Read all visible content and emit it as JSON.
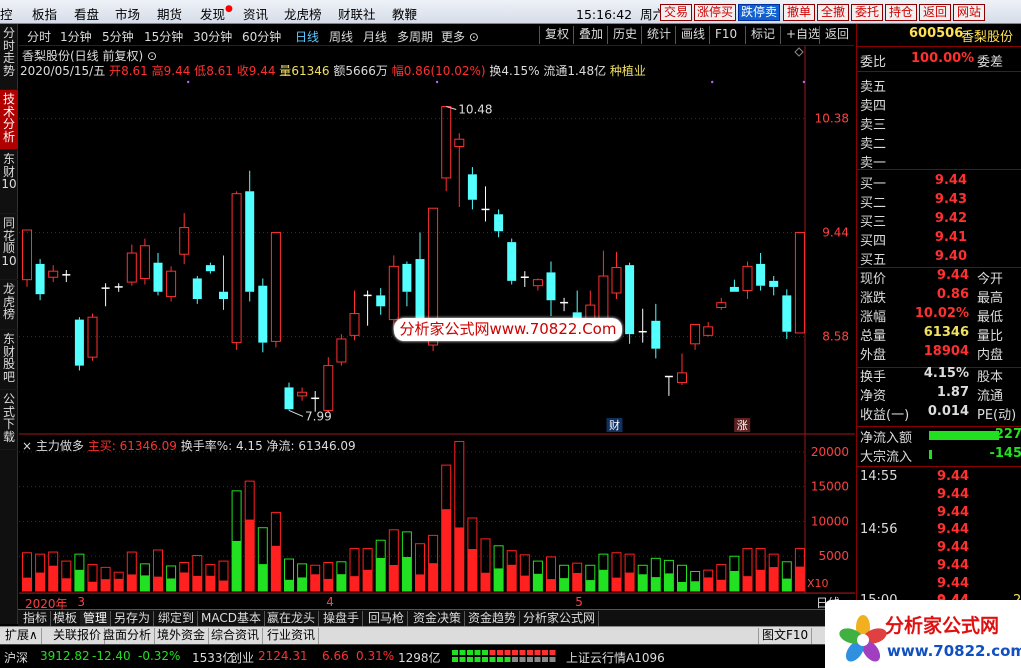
{
  "menubar": {
    "items": [
      "控",
      "板指",
      "看盘",
      "市场",
      "期货",
      "发现",
      "资讯",
      "龙虎榜",
      "财联社",
      "教鞭"
    ],
    "clock": "15:16:42",
    "weekday": "周六",
    "trade_buttons": [
      "交易",
      "涨停买",
      "跌停卖",
      "撤单",
      "全撤",
      "委托",
      "持仓",
      "返回",
      "网站"
    ]
  },
  "left_tabs": [
    {
      "label": "分时走势",
      "active": false
    },
    {
      "label": "技术分析",
      "active": true
    },
    {
      "label": "东财10",
      "active": false
    },
    {
      "label": "同花顺10",
      "active": false
    },
    {
      "label": "龙虎榜",
      "active": false
    },
    {
      "label": "东财股吧",
      "active": false
    },
    {
      "label": "公式下载",
      "active": false
    }
  ],
  "periods": [
    "分时",
    "1分钟",
    "5分钟",
    "15分钟",
    "30分钟",
    "60分钟",
    "日线",
    "周线",
    "月线",
    "多周期",
    "更多"
  ],
  "period_selected": "日线",
  "tools": [
    "复权",
    "叠加",
    "历史",
    "统计",
    "画线",
    "F10",
    "标记",
    "+自选",
    "返回"
  ],
  "stock": {
    "title": "香梨股份(日线 前复权)",
    "date": "2020/05/15/五",
    "open_label": "开",
    "open": "8.61",
    "high_label": "高",
    "high": "9.44",
    "low_label": "低",
    "low": "8.61",
    "close_label": "收",
    "close": "9.44",
    "vol_label": "量",
    "vol": "61346",
    "amt_label": "额",
    "amt": "5666万",
    "amp_label": "幅",
    "amp": "0.86(10.02%)",
    "turnover": "换4.15%",
    "float": "流通1.48亿",
    "sector": "种植业"
  },
  "watermark": "分析家公式网www.70822.Com",
  "sub_indicator": {
    "name": "主力做多",
    "buy_label": "主买:",
    "buy": "61346.09",
    "tr_label": "换手率%:",
    "tr": "4.15",
    "net_label": "净流:",
    "net": "61346.09"
  },
  "chart_data": {
    "type": "candlestick",
    "y_labels": [
      "10.38",
      "9.44",
      "8.58"
    ],
    "ylim": [
      7.8,
      10.6
    ],
    "hi_mark": "10.48",
    "lo_mark": "7.99",
    "vol_ticks": [
      "20000",
      "15000",
      "10000",
      "5000"
    ],
    "vol_scale": "X10",
    "vol_max": 22000,
    "candles": [
      [
        9.05,
        9.46,
        8.99,
        9.46
      ],
      [
        9.18,
        8.93,
        8.88,
        9.22
      ],
      [
        9.07,
        9.12,
        9.03,
        9.17
      ],
      [
        9.1,
        9.09,
        9.03,
        9.13
      ],
      [
        8.72,
        8.34,
        8.3,
        8.74
      ],
      [
        8.41,
        8.74,
        8.38,
        8.77
      ],
      [
        8.96,
        8.98,
        8.83,
        9.02
      ],
      [
        8.97,
        8.99,
        8.95,
        9.02
      ],
      [
        9.03,
        9.27,
        9.0,
        9.34
      ],
      [
        9.06,
        9.33,
        9.01,
        9.39
      ],
      [
        9.19,
        8.95,
        8.92,
        9.27
      ],
      [
        8.91,
        9.12,
        8.87,
        9.16
      ],
      [
        9.26,
        9.48,
        9.18,
        9.6
      ],
      [
        9.06,
        8.89,
        8.85,
        9.08
      ],
      [
        9.17,
        9.12,
        9.1,
        9.19
      ],
      [
        8.95,
        8.89,
        8.8,
        9.25
      ],
      [
        8.53,
        9.76,
        8.47,
        9.78
      ],
      [
        9.78,
        8.95,
        8.87,
        9.95
      ],
      [
        9.0,
        8.53,
        8.45,
        9.06
      ],
      [
        8.54,
        9.44,
        8.49,
        9.44
      ],
      [
        8.16,
        7.98,
        7.97,
        8.2
      ],
      [
        8.09,
        8.12,
        8.05,
        8.16
      ],
      [
        8.08,
        8.07,
        7.96,
        8.13
      ],
      [
        7.97,
        8.34,
        7.95,
        8.41
      ],
      [
        8.37,
        8.56,
        8.34,
        8.6
      ],
      [
        8.59,
        8.77,
        8.55,
        8.96
      ],
      [
        8.9,
        8.92,
        8.67,
        8.96
      ],
      [
        8.92,
        8.83,
        8.76,
        8.98
      ],
      [
        8.72,
        9.16,
        8.63,
        9.25
      ],
      [
        9.18,
        8.95,
        8.83,
        9.2
      ],
      [
        9.22,
        8.69,
        8.61,
        9.44
      ],
      [
        8.51,
        9.64,
        8.46,
        9.64
      ],
      [
        9.89,
        10.48,
        9.78,
        10.48
      ],
      [
        10.15,
        10.21,
        9.65,
        10.26
      ],
      [
        9.92,
        9.71,
        9.63,
        9.98
      ],
      [
        9.63,
        9.63,
        9.53,
        9.82
      ],
      [
        9.59,
        9.45,
        9.4,
        9.63
      ],
      [
        9.36,
        9.04,
        9.01,
        9.39
      ],
      [
        9.07,
        9.07,
        8.99,
        9.12
      ],
      [
        9.0,
        9.05,
        8.96,
        9.06
      ],
      [
        9.11,
        8.88,
        8.75,
        9.2
      ],
      [
        8.84,
        8.86,
        8.79,
        8.9
      ],
      [
        8.78,
        8.68,
        8.62,
        8.96
      ],
      [
        8.67,
        8.84,
        8.64,
        8.96
      ],
      [
        8.63,
        9.08,
        8.61,
        9.29
      ],
      [
        8.94,
        9.15,
        8.89,
        9.28
      ],
      [
        9.17,
        8.6,
        8.52,
        9.19
      ],
      [
        8.6,
        8.62,
        8.53,
        8.81
      ],
      [
        8.71,
        8.48,
        8.4,
        8.85
      ],
      [
        8.24,
        8.25,
        8.09,
        8.25
      ],
      [
        8.2,
        8.28,
        8.18,
        8.44
      ],
      [
        8.52,
        8.68,
        8.47,
        8.68
      ],
      [
        8.59,
        8.66,
        8.58,
        8.7
      ],
      [
        8.82,
        8.86,
        8.8,
        8.9
      ],
      [
        8.99,
        8.95,
        8.95,
        9.05
      ],
      [
        8.96,
        9.16,
        8.89,
        9.2
      ],
      [
        9.18,
        9.0,
        8.96,
        9.27
      ],
      [
        9.04,
        8.99,
        8.92,
        9.08
      ],
      [
        8.92,
        8.62,
        8.56,
        8.97
      ],
      [
        8.61,
        9.44,
        8.61,
        9.44
      ]
    ],
    "volumes": [
      [
        5500,
        1
      ],
      [
        5300,
        1
      ],
      [
        5600,
        1
      ],
      [
        4300,
        1
      ],
      [
        5300,
        0
      ],
      [
        3800,
        1
      ],
      [
        3400,
        1
      ],
      [
        2700,
        1
      ],
      [
        5600,
        1
      ],
      [
        3900,
        0
      ],
      [
        5900,
        1
      ],
      [
        3600,
        0
      ],
      [
        4100,
        1
      ],
      [
        5100,
        1
      ],
      [
        3800,
        1
      ],
      [
        4300,
        1
      ],
      [
        14400,
        0
      ],
      [
        15800,
        1
      ],
      [
        9100,
        0
      ],
      [
        11300,
        1
      ],
      [
        4600,
        0
      ],
      [
        3900,
        0
      ],
      [
        3700,
        1
      ],
      [
        4100,
        1
      ],
      [
        4200,
        0
      ],
      [
        6100,
        1
      ],
      [
        6100,
        1
      ],
      [
        7300,
        0
      ],
      [
        8800,
        1
      ],
      [
        8500,
        0
      ],
      [
        6800,
        1
      ],
      [
        8000,
        1
      ],
      [
        18100,
        1
      ],
      [
        21500,
        1
      ],
      [
        10500,
        1
      ],
      [
        7500,
        1
      ],
      [
        6500,
        0
      ],
      [
        5800,
        1
      ],
      [
        5200,
        1
      ],
      [
        4300,
        0
      ],
      [
        4900,
        1
      ],
      [
        3700,
        0
      ],
      [
        4000,
        1
      ],
      [
        3700,
        0
      ],
      [
        5300,
        0
      ],
      [
        5500,
        1
      ],
      [
        5300,
        1
      ],
      [
        3700,
        0
      ],
      [
        4700,
        0
      ],
      [
        4400,
        0
      ],
      [
        3700,
        0
      ],
      [
        2800,
        0
      ],
      [
        3000,
        1
      ],
      [
        3800,
        1
      ],
      [
        5000,
        0
      ],
      [
        6100,
        1
      ],
      [
        6100,
        1
      ],
      [
        5300,
        1
      ],
      [
        4200,
        0
      ],
      [
        6100,
        1
      ]
    ],
    "x_labels": [
      {
        "label": "2020年",
        "idx": 0
      },
      {
        "label": "3",
        "idx": 4
      },
      {
        "label": "4",
        "idx": 23
      },
      {
        "label": "5",
        "idx": 42
      }
    ],
    "period_label": "日线",
    "badges": [
      {
        "label": "财",
        "idx": 45
      },
      {
        "label": "涨",
        "idx": 52
      }
    ]
  },
  "indicator_tabs": [
    "指标",
    "模板",
    "管理",
    "另存为",
    "绑定到",
    "MACD基本",
    "嬴在龙头",
    "操盘手",
    "回马枪",
    "资金决策",
    "资金趋势",
    "分析家公式网"
  ],
  "ext_tabs": [
    "扩展∧",
    "关联报价",
    "盘面分析",
    "境外资金",
    "综合资讯",
    "行业资讯"
  ],
  "ext_right": "图文F10",
  "status": {
    "sh_label": "沪深",
    "sh": "3912.82",
    "sh_chg": "-12.40",
    "sh_pct": "-0.32%",
    "sh_amt": "1533亿",
    "cy_label": "创业",
    "cy": "2124.31",
    "cy_chg": "6.66",
    "cy_pct": "0.31%",
    "cy_amt": "1298亿",
    "cloud": "上证云行情A1096"
  },
  "quote": {
    "code": "600506",
    "name": "香梨股份",
    "weibi_label": "委比",
    "weibi": "100.00%",
    "weicha_label": "委差",
    "sells": [
      "卖五",
      "卖四",
      "卖三",
      "卖二",
      "卖一"
    ],
    "buys": [
      {
        "l": "买一",
        "p": "9.44"
      },
      {
        "l": "买二",
        "p": "9.43"
      },
      {
        "l": "买三",
        "p": "9.42"
      },
      {
        "l": "买四",
        "p": "9.41"
      },
      {
        "l": "买五",
        "p": "9.40"
      }
    ],
    "stats": [
      {
        "l": "现价",
        "v": "9.44",
        "r": "今开",
        "c": "red"
      },
      {
        "l": "涨跌",
        "v": "0.86",
        "r": "最高",
        "c": "red"
      },
      {
        "l": "涨幅",
        "v": "10.02%",
        "r": "最低",
        "c": "red"
      },
      {
        "l": "总量",
        "v": "61346",
        "r": "量比",
        "c": "yel"
      },
      {
        "l": "外盘",
        "v": "18904",
        "r": "内盘",
        "c": "red"
      }
    ],
    "stats2": [
      {
        "l": "换手",
        "v": "4.15%",
        "r": "股本"
      },
      {
        "l": "净资",
        "v": "1.87",
        "r": "流通"
      },
      {
        "l": "收益(一)",
        "v": "0.014",
        "r": "PE(动)"
      }
    ],
    "flow": [
      {
        "l": "净流入额",
        "v": "-227",
        "w": 70
      },
      {
        "l": "大宗流入",
        "v": "-145",
        "w": 3
      }
    ],
    "ticks": [
      {
        "t": "14:55",
        "p": "9.44"
      },
      {
        "t": "",
        "p": "9.44"
      },
      {
        "t": "",
        "p": "9.44"
      },
      {
        "t": "14:56",
        "p": "9.44"
      },
      {
        "t": "",
        "p": "9.44"
      },
      {
        "t": "",
        "p": "9.44"
      },
      {
        "t": "",
        "p": "9.44"
      },
      {
        "t": "",
        "p": "9.44"
      },
      {
        "t": "15:00",
        "p": "9.44"
      }
    ],
    "last_vol": "2"
  }
}
